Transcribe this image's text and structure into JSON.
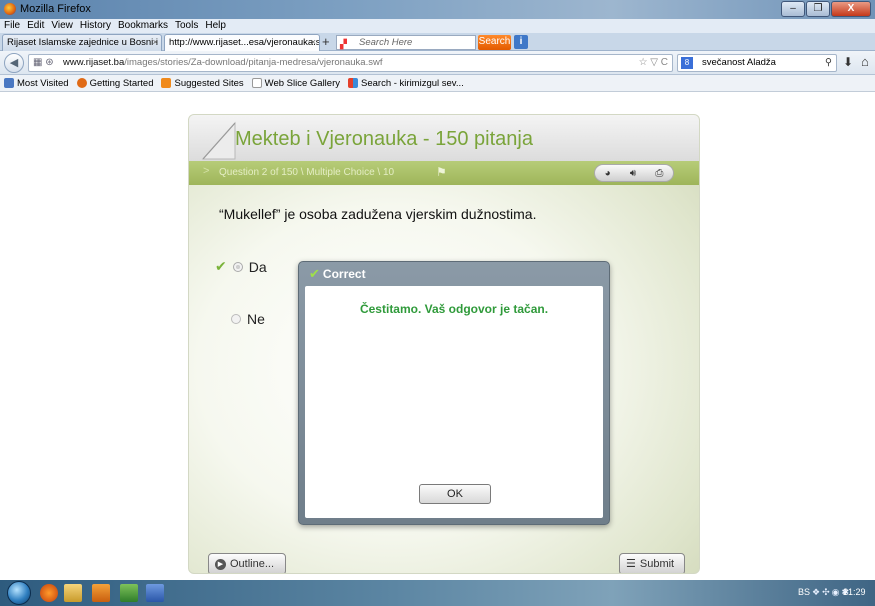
{
  "window": {
    "title": "Mozilla Firefox",
    "minimize": "‒",
    "restore": "❐",
    "close": "X"
  },
  "menu": [
    "File",
    "Edit",
    "View",
    "History",
    "Bookmarks",
    "Tools",
    "Help"
  ],
  "tabs": [
    {
      "label": "Rijaset Islamske zajednice u Bosni i H...",
      "close": "×"
    },
    {
      "label": "http://www.rijaset...esa/vjeronauka.swf",
      "close": "×"
    }
  ],
  "toolbar": {
    "new_tab": "+",
    "search_placeholder": "Search Here",
    "search_button": "Search",
    "info_button": "i"
  },
  "navbar": {
    "url_host": "www.rijaset.ba",
    "url_path": "/images/stories/Za-download/pitanja-medresa/vjeronauka.swf",
    "url_end": "☆ ▽ C",
    "search_value": "svečanost Aladža",
    "search_engine": "8"
  },
  "bookmarks": [
    {
      "label": "Most Visited",
      "color": "#4a78c2"
    },
    {
      "label": "Getting Started",
      "color": "#e06a16"
    },
    {
      "label": "Suggested Sites",
      "color": "#f08a1c"
    },
    {
      "label": "Web Slice Gallery",
      "color": "#ffffff"
    },
    {
      "label": "Search - kirimizgul sev...",
      "color": "#e4402b"
    }
  ],
  "quiz": {
    "title": "Mekteb i Vjeronauka - 150 pitanja",
    "progress": "Question 2 of 150 \\ Multiple Choice \\ 10",
    "question": "“Mukellef”  je osoba zadužena vjerskim dužnostima.",
    "answers": [
      {
        "label": "Da",
        "selected": true,
        "correct_mark": "✔"
      },
      {
        "label": "Ne",
        "selected": false
      }
    ],
    "outline_button": "Outline...",
    "submit_button": "Submit"
  },
  "dialog": {
    "title": "Correct",
    "message": "Čestitamo. Vaš odgovor je tačan.",
    "ok_button": "OK"
  },
  "taskbar": {
    "language": "BS",
    "clock": "21:29"
  },
  "colors": {
    "accent_green": "#7aa43a",
    "progress_green": "#9eb55a",
    "correct_text": "#2f9a3a"
  }
}
